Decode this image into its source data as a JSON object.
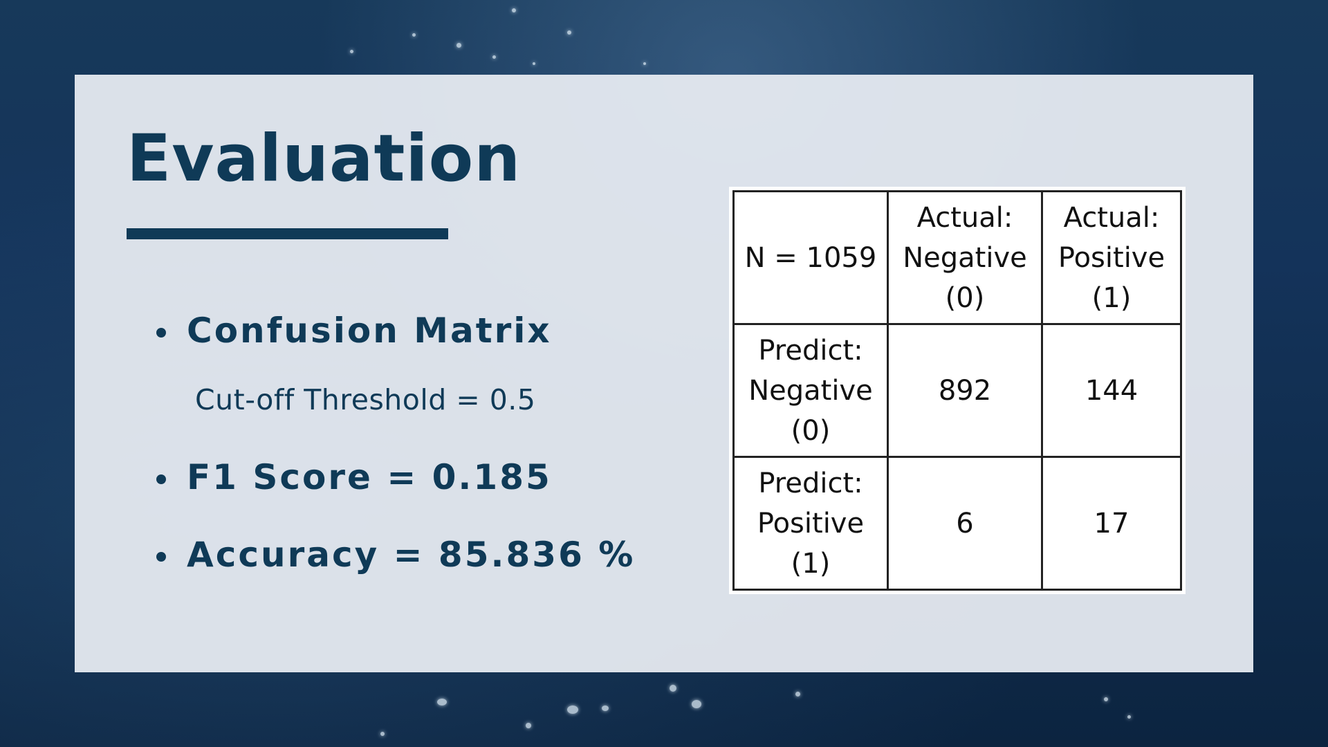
{
  "slide": {
    "title": "Evaluation",
    "bullets": [
      {
        "label": "Confusion Matrix"
      },
      {
        "label": "F1 Score = 0.185"
      },
      {
        "label": "Accuracy = 85.836 %"
      }
    ],
    "subtext": "Cut-off Threshold = 0.5"
  },
  "matrix": {
    "corner": "N = 1059",
    "col_headers": [
      [
        "Actual:",
        "Negative",
        "(0)"
      ],
      [
        "Actual:",
        "Positive",
        "(1)"
      ]
    ],
    "row_headers": [
      [
        "Predict:",
        "Negative",
        "(0)"
      ],
      [
        "Predict:",
        "Positive",
        "(1)"
      ]
    ],
    "cells": [
      [
        "892",
        "144"
      ],
      [
        "6",
        "17"
      ]
    ]
  },
  "colors": {
    "accent": "#0f3a57",
    "panel": "#e8ecf2",
    "background": "#14335a"
  }
}
